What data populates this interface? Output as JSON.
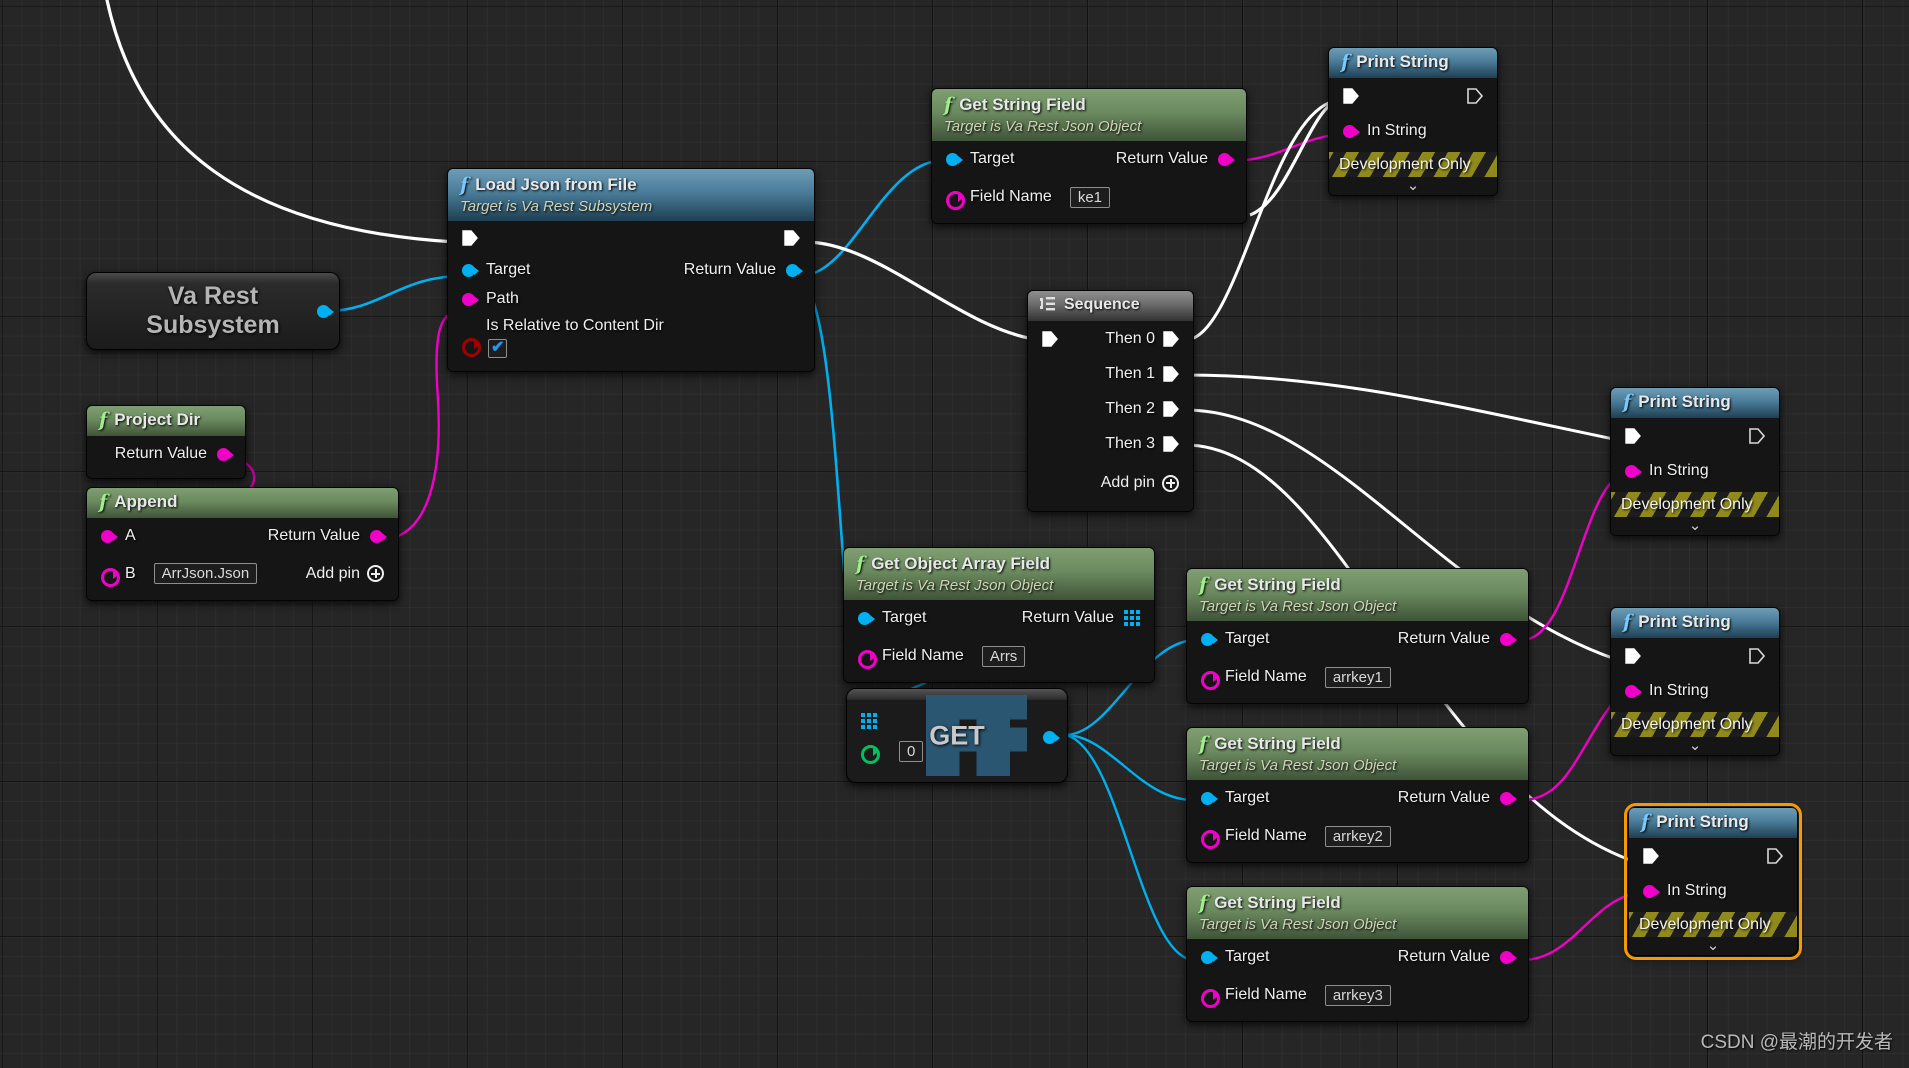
{
  "app": {
    "kind": "unreal-blueprint-graph",
    "watermark": "CSDN @最潮的开发者"
  },
  "colors": {
    "exec_white": "#ffffff",
    "object_blue": "#00b0f0",
    "string_pink": "#f000c8",
    "bool_red": "#a00000",
    "int_green": "#00c060",
    "selection_orange": "#f59a00",
    "func_header_green": "#6b8a5f",
    "event_header_blue": "#4a7c99"
  },
  "nodes": {
    "va_rest_subsystem": {
      "title": "Va Rest Subsystem",
      "line1": "Va Rest",
      "line2": "Subsystem",
      "out_pin": "object"
    },
    "load_json_from_file": {
      "title": "Load Json from File",
      "subtitle": "Target is Va Rest Subsystem",
      "icon": "function-f-icon",
      "inputs": [
        {
          "label": "Target",
          "pin": "object"
        },
        {
          "label": "Path",
          "pin": "string"
        },
        {
          "label": "Is Relative to Content Dir",
          "pin": "bool",
          "value": "checked"
        }
      ],
      "outputs": [
        {
          "label": "Return Value",
          "pin": "object"
        }
      ]
    },
    "project_dir": {
      "title": "Project Dir",
      "icon": "function-f-icon",
      "outputs": [
        {
          "label": "Return Value",
          "pin": "string"
        }
      ]
    },
    "append": {
      "title": "Append",
      "icon": "function-f-icon",
      "inputs": [
        {
          "label": "A",
          "pin": "string",
          "value": ""
        },
        {
          "label": "B",
          "pin": "string",
          "value": "ArrJson.Json"
        }
      ],
      "outputs": [
        {
          "label": "Return Value",
          "pin": "string"
        }
      ],
      "add_pin_label": "Add pin"
    },
    "get_string_field_top": {
      "title": "Get String Field",
      "subtitle": "Target is Va Rest Json Object",
      "icon": "function-f-icon",
      "inputs": [
        {
          "label": "Target",
          "pin": "object"
        },
        {
          "label": "Field Name",
          "pin": "string",
          "value": "ke1"
        }
      ],
      "outputs": [
        {
          "label": "Return Value",
          "pin": "string"
        }
      ]
    },
    "print_string_1": {
      "title": "Print String",
      "icon": "function-f-icon",
      "in_string_label": "In String",
      "dev_only_label": "Development Only",
      "selected": false
    },
    "sequence": {
      "title": "Sequence",
      "icon": "sequence-icon",
      "outputs": [
        "Then 0",
        "Then 1",
        "Then 2",
        "Then 3"
      ],
      "add_pin_label": "Add pin"
    },
    "get_object_array_field": {
      "title": "Get Object Array Field",
      "subtitle": "Target is Va Rest Json Object",
      "icon": "function-f-icon",
      "inputs": [
        {
          "label": "Target",
          "pin": "object"
        },
        {
          "label": "Field Name",
          "pin": "string",
          "value": "Arrs"
        }
      ],
      "outputs": [
        {
          "label": "Return Value",
          "pin": "object-array"
        }
      ]
    },
    "array_get": {
      "title": "GET",
      "index_value": "0",
      "index_pin": "int",
      "array_pin": "object-array",
      "out_pin": "object"
    },
    "get_string_field_1": {
      "title": "Get String Field",
      "subtitle": "Target is Va Rest Json Object",
      "icon": "function-f-icon",
      "inputs": [
        {
          "label": "Target",
          "pin": "object"
        },
        {
          "label": "Field Name",
          "pin": "string",
          "value": "arrkey1"
        }
      ],
      "outputs": [
        {
          "label": "Return Value",
          "pin": "string"
        }
      ]
    },
    "get_string_field_2": {
      "title": "Get String Field",
      "subtitle": "Target is Va Rest Json Object",
      "icon": "function-f-icon",
      "inputs": [
        {
          "label": "Target",
          "pin": "object"
        },
        {
          "label": "Field Name",
          "pin": "string",
          "value": "arrkey2"
        }
      ],
      "outputs": [
        {
          "label": "Return Value",
          "pin": "string"
        }
      ]
    },
    "get_string_field_3": {
      "title": "Get String Field",
      "subtitle": "Target is Va Rest Json Object",
      "icon": "function-f-icon",
      "inputs": [
        {
          "label": "Target",
          "pin": "object"
        },
        {
          "label": "Field Name",
          "pin": "string",
          "value": "arrkey3"
        }
      ],
      "outputs": [
        {
          "label": "Return Value",
          "pin": "string"
        }
      ]
    },
    "print_string_2": {
      "title": "Print String",
      "icon": "function-f-icon",
      "in_string_label": "In String",
      "dev_only_label": "Development Only",
      "selected": false
    },
    "print_string_3": {
      "title": "Print String",
      "icon": "function-f-icon",
      "in_string_label": "In String",
      "dev_only_label": "Development Only",
      "selected": false
    },
    "print_string_4": {
      "title": "Print String",
      "icon": "function-f-icon",
      "in_string_label": "In String",
      "dev_only_label": "Development Only",
      "selected": true
    }
  }
}
